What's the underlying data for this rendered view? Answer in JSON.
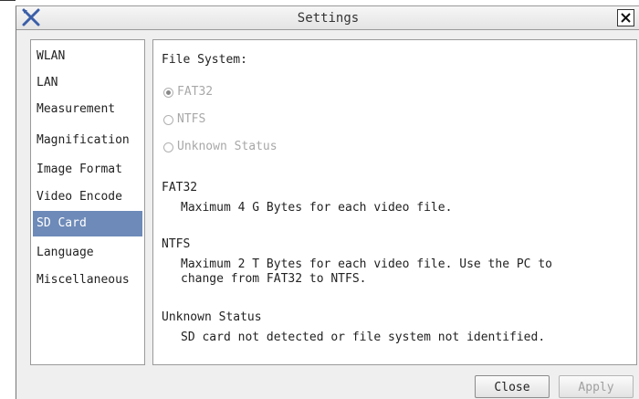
{
  "window": {
    "title": "Settings",
    "app_icon": "cross-tools-icon",
    "close_icon": "close-icon"
  },
  "sidebar": {
    "items": [
      {
        "label": "WLAN"
      },
      {
        "label": "LAN"
      },
      {
        "label": "Measurement"
      },
      {
        "label": "Magnification"
      },
      {
        "label": "Image Format"
      },
      {
        "label": "Video Encode"
      },
      {
        "label": "SD Card",
        "selected": true
      },
      {
        "label": "Language"
      },
      {
        "label": "Miscellaneous"
      }
    ]
  },
  "panel": {
    "heading": "File System:",
    "options": [
      {
        "label": "FAT32",
        "checked": true,
        "enabled": false
      },
      {
        "label": "NTFS",
        "checked": false,
        "enabled": false
      },
      {
        "label": "Unknown Status",
        "checked": false,
        "enabled": false
      }
    ],
    "sections": [
      {
        "title": "FAT32",
        "desc": "Maximum 4 G Bytes for each video file."
      },
      {
        "title": "NTFS",
        "desc": "Maximum 2 T Bytes for each video file. Use the PC to\nchange from FAT32 to NTFS."
      },
      {
        "title": "Unknown Status",
        "desc": "SD card not detected or file system not identified."
      }
    ]
  },
  "buttons": {
    "close": "Close",
    "apply": "Apply"
  },
  "colors": {
    "selection": "#6d8ab8",
    "icon_blue": "#3b5fa8"
  }
}
